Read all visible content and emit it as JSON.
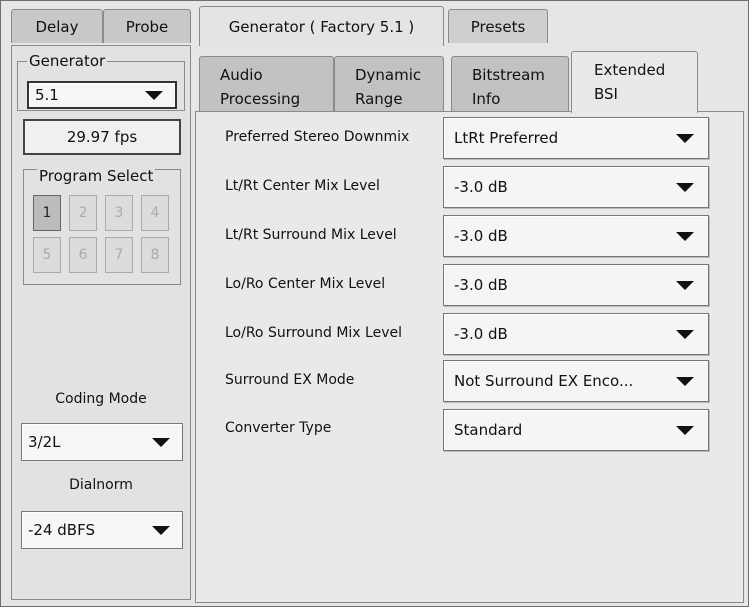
{
  "top_tabs": [
    "Delay",
    "Probe",
    "Generator ( Factory 5.1 )",
    "Presets"
  ],
  "generator": {
    "group_label": "Generator",
    "selected": "5.1",
    "fps": "29.97 fps"
  },
  "program_select": {
    "label": "Program Select",
    "buttons": [
      "1",
      "2",
      "3",
      "4",
      "5",
      "6",
      "7",
      "8"
    ],
    "active": "1"
  },
  "coding_mode": {
    "label": "Coding Mode",
    "value": "3/2L"
  },
  "dialnorm": {
    "label": "Dialnorm",
    "value": "-24 dBFS"
  },
  "sub_tabs": [
    {
      "line1": "Audio",
      "line2": "Processing"
    },
    {
      "line1": "Dynamic",
      "line2": "Range"
    },
    {
      "line1": "Bitstream",
      "line2": "Info"
    },
    {
      "line1": "Extended",
      "line2": "BSI"
    }
  ],
  "settings": [
    {
      "label": "Preferred Stereo Downmix",
      "value": "LtRt Preferred"
    },
    {
      "label": "Lt/Rt Center Mix Level",
      "value": "-3.0 dB"
    },
    {
      "label": "Lt/Rt Surround Mix Level",
      "value": "-3.0 dB"
    },
    {
      "label": "Lo/Ro Center Mix Level",
      "value": "-3.0 dB"
    },
    {
      "label": "Lo/Ro Surround Mix Level",
      "value": "-3.0 dB"
    },
    {
      "label": "Surround EX Mode",
      "value": "Not Surround EX Enco..."
    },
    {
      "label": "Converter Type",
      "value": "Standard"
    }
  ]
}
